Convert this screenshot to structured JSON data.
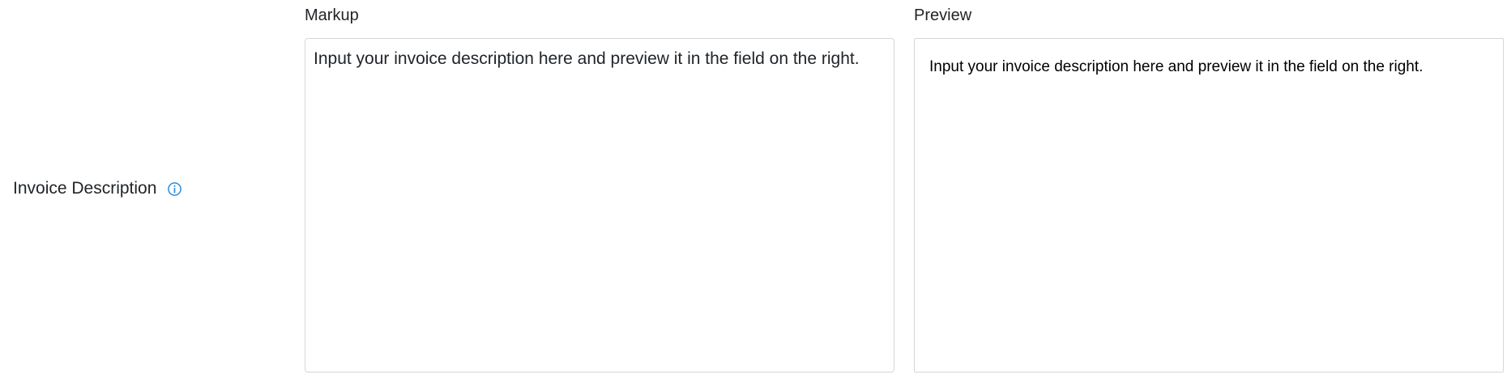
{
  "field": {
    "label": "Invoice Description",
    "info_icon": "info-circle-icon",
    "accent_color": "#2f8cdc"
  },
  "markup": {
    "label": "Markup",
    "value": "Input your invoice description here and preview it in the field on the right."
  },
  "preview": {
    "label": "Preview",
    "text": "Input your invoice description here and preview it in the field on the right."
  }
}
